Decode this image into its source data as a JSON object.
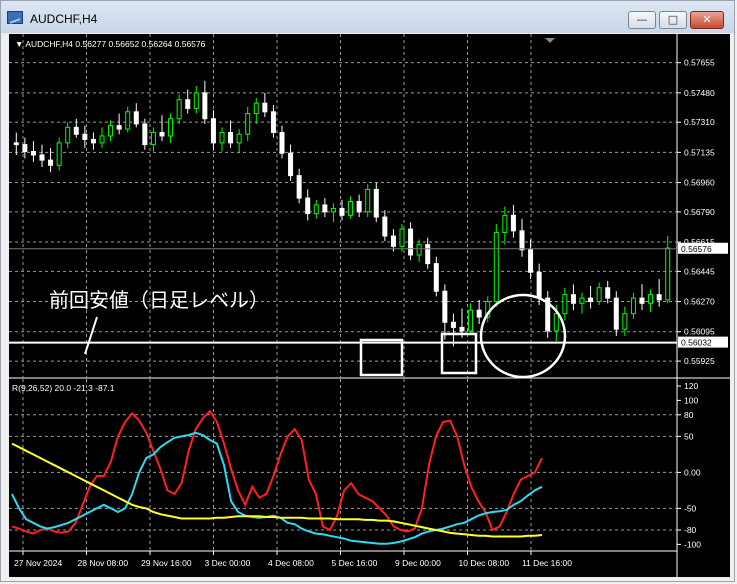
{
  "window": {
    "title": "AUDCHF,H4",
    "controls": {
      "minimize": "—",
      "maximize": "□",
      "close": "✕"
    }
  },
  "chart_data": [
    {
      "type": "candlestick",
      "title": "AUDCHF,H4  0.56277 0.56652 0.56264 0.56576",
      "y_ticks": [
        "0.57655",
        "0.57480",
        "0.57310",
        "0.57135",
        "0.56960",
        "0.56790",
        "0.56615",
        "0.56445",
        "0.56270",
        "0.56095",
        "0.55925"
      ],
      "ylim": [
        0.5585,
        0.5774
      ],
      "current_price": "0.56576",
      "line_price": "0.56032",
      "line_value": 0.56032,
      "current_value": 0.56576,
      "annotation": "前回安値（日足レベル）",
      "bull_color": "#00ff00",
      "bear_color": "#ffffff",
      "candles": [
        [
          0.5719,
          0.5725,
          0.5712,
          0.5718
        ],
        [
          0.5718,
          0.5722,
          0.571,
          0.5714
        ],
        [
          0.5714,
          0.572,
          0.5708,
          0.5712
        ],
        [
          0.5712,
          0.5718,
          0.5705,
          0.5709
        ],
        [
          0.5709,
          0.5716,
          0.5702,
          0.5706
        ],
        [
          0.5706,
          0.5722,
          0.5703,
          0.5719
        ],
        [
          0.5719,
          0.5731,
          0.5716,
          0.5728
        ],
        [
          0.5728,
          0.5733,
          0.5722,
          0.5724
        ],
        [
          0.5724,
          0.5729,
          0.5716,
          0.5721
        ],
        [
          0.5721,
          0.5725,
          0.5715,
          0.5719
        ],
        [
          0.5719,
          0.5728,
          0.5716,
          0.5723
        ],
        [
          0.5723,
          0.5732,
          0.572,
          0.5729
        ],
        [
          0.5729,
          0.5736,
          0.5724,
          0.5727
        ],
        [
          0.5727,
          0.574,
          0.5725,
          0.5737
        ],
        [
          0.5737,
          0.5742,
          0.5728,
          0.573
        ],
        [
          0.573,
          0.5733,
          0.5715,
          0.5718
        ],
        [
          0.5718,
          0.5728,
          0.5714,
          0.5725
        ],
        [
          0.5725,
          0.5735,
          0.572,
          0.5723
        ],
        [
          0.5723,
          0.5736,
          0.5719,
          0.5733
        ],
        [
          0.5733,
          0.5747,
          0.573,
          0.5744
        ],
        [
          0.5744,
          0.575,
          0.5736,
          0.5739
        ],
        [
          0.5739,
          0.5752,
          0.5736,
          0.5748
        ],
        [
          0.5748,
          0.5755,
          0.573,
          0.5733
        ],
        [
          0.5733,
          0.5738,
          0.5715,
          0.5719
        ],
        [
          0.5719,
          0.5728,
          0.5714,
          0.5725
        ],
        [
          0.5725,
          0.5732,
          0.5716,
          0.5719
        ],
        [
          0.5719,
          0.5727,
          0.5713,
          0.5724
        ],
        [
          0.5724,
          0.574,
          0.572,
          0.5736
        ],
        [
          0.5736,
          0.5745,
          0.573,
          0.5742
        ],
        [
          0.5742,
          0.5748,
          0.5734,
          0.5737
        ],
        [
          0.5737,
          0.5741,
          0.5722,
          0.5725
        ],
        [
          0.5725,
          0.5729,
          0.571,
          0.5713
        ],
        [
          0.5713,
          0.5718,
          0.5697,
          0.57
        ],
        [
          0.57,
          0.5704,
          0.5684,
          0.5687
        ],
        [
          0.5687,
          0.5692,
          0.5674,
          0.5678
        ],
        [
          0.5678,
          0.5686,
          0.5675,
          0.5683
        ],
        [
          0.5683,
          0.5687,
          0.5676,
          0.5679
        ],
        [
          0.5679,
          0.5684,
          0.5673,
          0.5681
        ],
        [
          0.5681,
          0.5686,
          0.5674,
          0.5677
        ],
        [
          0.5677,
          0.5688,
          0.5675,
          0.5685
        ],
        [
          0.5685,
          0.5689,
          0.5676,
          0.5679
        ],
        [
          0.5679,
          0.5695,
          0.5676,
          0.5692
        ],
        [
          0.5692,
          0.5696,
          0.5673,
          0.5676
        ],
        [
          0.5676,
          0.568,
          0.5662,
          0.5665
        ],
        [
          0.5665,
          0.5669,
          0.5656,
          0.5659
        ],
        [
          0.5659,
          0.5672,
          0.5656,
          0.5669
        ],
        [
          0.5669,
          0.5673,
          0.5651,
          0.5654
        ],
        [
          0.5654,
          0.5663,
          0.565,
          0.566
        ],
        [
          0.566,
          0.5664,
          0.5646,
          0.5649
        ],
        [
          0.5649,
          0.5653,
          0.563,
          0.5633
        ],
        [
          0.5633,
          0.5637,
          0.5605,
          0.5615
        ],
        [
          0.5615,
          0.562,
          0.5601,
          0.5612
        ],
        [
          0.5612,
          0.5623,
          0.5606,
          0.561
        ],
        [
          0.561,
          0.5626,
          0.5608,
          0.5622
        ],
        [
          0.5622,
          0.5628,
          0.5614,
          0.5618
        ],
        [
          0.5618,
          0.563,
          0.5615,
          0.5627
        ],
        [
          0.5627,
          0.5672,
          0.5624,
          0.5667
        ],
        [
          0.5667,
          0.5682,
          0.566,
          0.5677
        ],
        [
          0.5677,
          0.5683,
          0.5664,
          0.5668
        ],
        [
          0.5668,
          0.5675,
          0.5653,
          0.5657
        ],
        [
          0.5657,
          0.5663,
          0.564,
          0.5644
        ],
        [
          0.5644,
          0.5649,
          0.5625,
          0.5629
        ],
        [
          0.5629,
          0.5633,
          0.5606,
          0.561
        ],
        [
          0.561,
          0.5625,
          0.5604,
          0.562
        ],
        [
          0.562,
          0.5635,
          0.5616,
          0.5631
        ],
        [
          0.5631,
          0.5637,
          0.5622,
          0.5626
        ],
        [
          0.5626,
          0.5632,
          0.562,
          0.5629
        ],
        [
          0.5629,
          0.5636,
          0.5623,
          0.5627
        ],
        [
          0.5627,
          0.5638,
          0.5625,
          0.5635
        ],
        [
          0.5635,
          0.5639,
          0.5626,
          0.5629
        ],
        [
          0.5629,
          0.5633,
          0.5607,
          0.5611
        ],
        [
          0.5611,
          0.5624,
          0.5607,
          0.562
        ],
        [
          0.562,
          0.5632,
          0.5617,
          0.5629
        ],
        [
          0.5629,
          0.5637,
          0.5622,
          0.5626
        ],
        [
          0.5626,
          0.5634,
          0.5621,
          0.5631
        ],
        [
          0.5631,
          0.564,
          0.5624,
          0.5628
        ],
        [
          0.5628,
          0.5665,
          0.5626,
          0.5658
        ]
      ]
    },
    {
      "type": "line",
      "title": "R(9,26,52) 20.0 -21.3 -87.1",
      "y_ticks": [
        "120",
        "100",
        "80",
        "50",
        "0.00",
        "-50",
        "-80",
        "-100"
      ],
      "ylim": [
        -105,
        120
      ],
      "x_tick_labels": [
        "27 Nov 2024",
        "28 Nov 08:00",
        "29 Nov 16:00",
        "3 Dec 00:00",
        "4 Dec 08:00",
        "5 Dec 16:00",
        "9 Dec 00:00",
        "10 Dec 08:00",
        "11 Dec 16:00"
      ],
      "series": [
        {
          "color": "#ff2020",
          "values": [
            -75,
            -78,
            -82,
            -85,
            -80,
            -78,
            -82,
            -84,
            -82,
            -70,
            -45,
            -20,
            -5,
            -5,
            15,
            50,
            70,
            82,
            72,
            55,
            30,
            5,
            -25,
            -30,
            -15,
            30,
            60,
            75,
            85,
            70,
            40,
            5,
            -25,
            -45,
            -20,
            -35,
            -30,
            -5,
            25,
            50,
            60,
            45,
            -10,
            -30,
            -75,
            -80,
            -60,
            -25,
            -15,
            -30,
            -35,
            -40,
            -50,
            -60,
            -75,
            -80,
            -82,
            -78,
            -50,
            10,
            50,
            70,
            72,
            50,
            10,
            -20,
            -40,
            -55,
            -80,
            -75,
            -55,
            -30,
            -10,
            -5,
            0,
            20
          ]
        },
        {
          "color": "#30d8f0",
          "values": [
            -30,
            -50,
            -65,
            -70,
            -75,
            -78,
            -76,
            -73,
            -70,
            -65,
            -60,
            -55,
            -50,
            -45,
            -50,
            -55,
            -50,
            -30,
            0,
            20,
            25,
            35,
            42,
            48,
            50,
            52,
            55,
            52,
            45,
            40,
            10,
            -40,
            -55,
            -60,
            -62,
            -63,
            -62,
            -60,
            -63,
            -70,
            -72,
            -78,
            -82,
            -85,
            -86,
            -88,
            -90,
            -92,
            -95,
            -96,
            -97,
            -98,
            -99,
            -99,
            -98,
            -96,
            -93,
            -90,
            -85,
            -82,
            -80,
            -78,
            -75,
            -72,
            -70,
            -65,
            -60,
            -57,
            -55,
            -54,
            -52,
            -45,
            -40,
            -32,
            -25,
            -20
          ]
        },
        {
          "color": "#ffff30",
          "values": [
            40,
            35,
            30,
            25,
            20,
            15,
            10,
            5,
            0,
            -5,
            -10,
            -15,
            -20,
            -25,
            -30,
            -35,
            -40,
            -45,
            -48,
            -50,
            -55,
            -58,
            -60,
            -62,
            -64,
            -64,
            -64,
            -64,
            -64,
            -63,
            -63,
            -62,
            -61,
            -61,
            -61,
            -61,
            -62,
            -62,
            -63,
            -63,
            -63,
            -63,
            -64,
            -64,
            -64,
            -64,
            -65,
            -65,
            -65,
            -65,
            -66,
            -66,
            -67,
            -67,
            -68,
            -70,
            -72,
            -74,
            -76,
            -78,
            -80,
            -82,
            -84,
            -85,
            -86,
            -87,
            -88,
            -88,
            -89,
            -89,
            -89,
            -89,
            -89,
            -88,
            -88,
            -87
          ]
        }
      ]
    }
  ]
}
